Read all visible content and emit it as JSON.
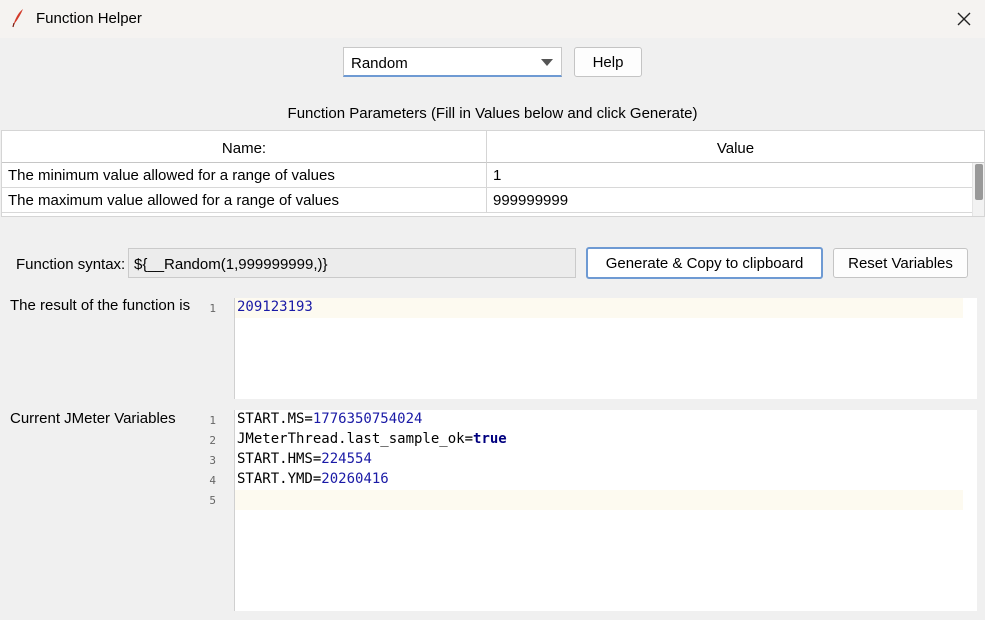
{
  "window": {
    "title": "Function Helper"
  },
  "function_select": {
    "selected": "Random"
  },
  "help_label": "Help",
  "params_title": "Function Parameters (Fill in Values below and click Generate)",
  "table": {
    "headers": [
      "Name:",
      "Value"
    ],
    "rows": [
      {
        "name": "The minimum value allowed for a range of values",
        "value": "1"
      },
      {
        "name": "The maximum value allowed for a range of values",
        "value": "999999999"
      }
    ]
  },
  "syntax": {
    "label": "Function syntax:",
    "value": "${__Random(1,999999999,)}"
  },
  "buttons": {
    "generate": "Generate & Copy to clipboard",
    "reset": "Reset Variables"
  },
  "result": {
    "label": "The result of the function is",
    "lines": [
      {
        "num": "1",
        "text": "209123193"
      }
    ]
  },
  "variables": {
    "label": "Current JMeter Variables",
    "lines": [
      {
        "num": "1",
        "key": "START.MS=",
        "value": "1776350754024"
      },
      {
        "num": "2",
        "key": "JMeterThread.last_sample_ok=",
        "value": "true"
      },
      {
        "num": "3",
        "key": "START.HMS=",
        "value": "224554"
      },
      {
        "num": "4",
        "key": "START.YMD=",
        "value": "20260416"
      },
      {
        "num": "5",
        "key": "",
        "value": ""
      }
    ]
  },
  "colors": {
    "number": "#1a1aa6",
    "keyword": "#00007f",
    "focus_border": "#6e9ad3",
    "current_line": "#fdfaf0"
  },
  "icons": {
    "app": "feather-icon",
    "close": "close-icon",
    "dropdown": "chevron-down-icon"
  }
}
